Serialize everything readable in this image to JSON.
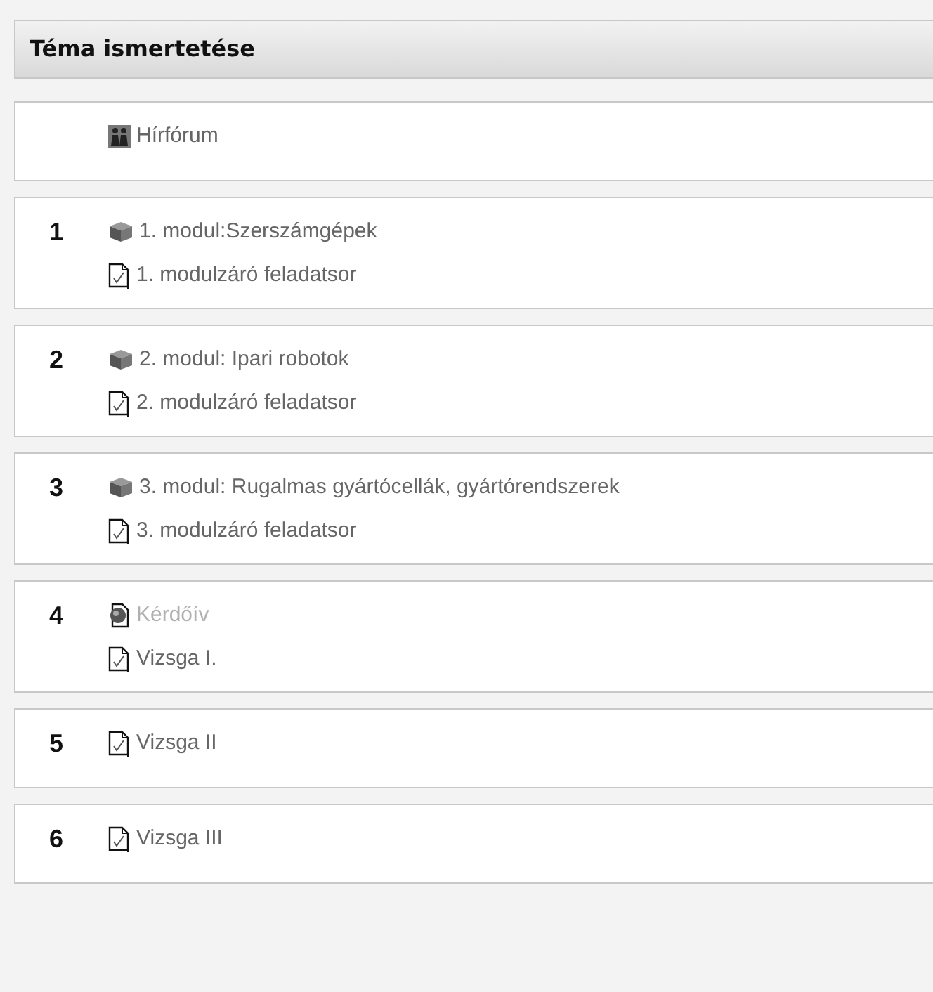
{
  "heading": "Téma ismertetése",
  "sections": [
    {
      "items": [
        {
          "kind": "forum",
          "label": "Hírfórum",
          "dimmed": false
        }
      ]
    },
    {
      "number": "1",
      "items": [
        {
          "kind": "module",
          "label": "1. modul:Szerszámgépek",
          "dimmed": false
        },
        {
          "kind": "quiz",
          "label": "1. modulzáró feladatsor",
          "dimmed": false
        }
      ]
    },
    {
      "number": "2",
      "items": [
        {
          "kind": "module",
          "label": "2. modul: Ipari robotok",
          "dimmed": false
        },
        {
          "kind": "quiz",
          "label": "2. modulzáró feladatsor",
          "dimmed": false
        }
      ]
    },
    {
      "number": "3",
      "items": [
        {
          "kind": "module",
          "label": "3. modul: Rugalmas gyártócellák, gyártórendszerek",
          "dimmed": false
        },
        {
          "kind": "quiz",
          "label": "3. modulzáró feladatsor",
          "dimmed": false
        }
      ]
    },
    {
      "number": "4",
      "items": [
        {
          "kind": "feedback",
          "label": "Kérdőív",
          "dimmed": true
        },
        {
          "kind": "quiz",
          "label": "Vizsga I.",
          "dimmed": false
        }
      ]
    },
    {
      "number": "5",
      "items": [
        {
          "kind": "quiz",
          "label": "Vizsga II",
          "dimmed": false
        }
      ]
    },
    {
      "number": "6",
      "items": [
        {
          "kind": "quiz",
          "label": "Vizsga III",
          "dimmed": false
        }
      ]
    }
  ]
}
